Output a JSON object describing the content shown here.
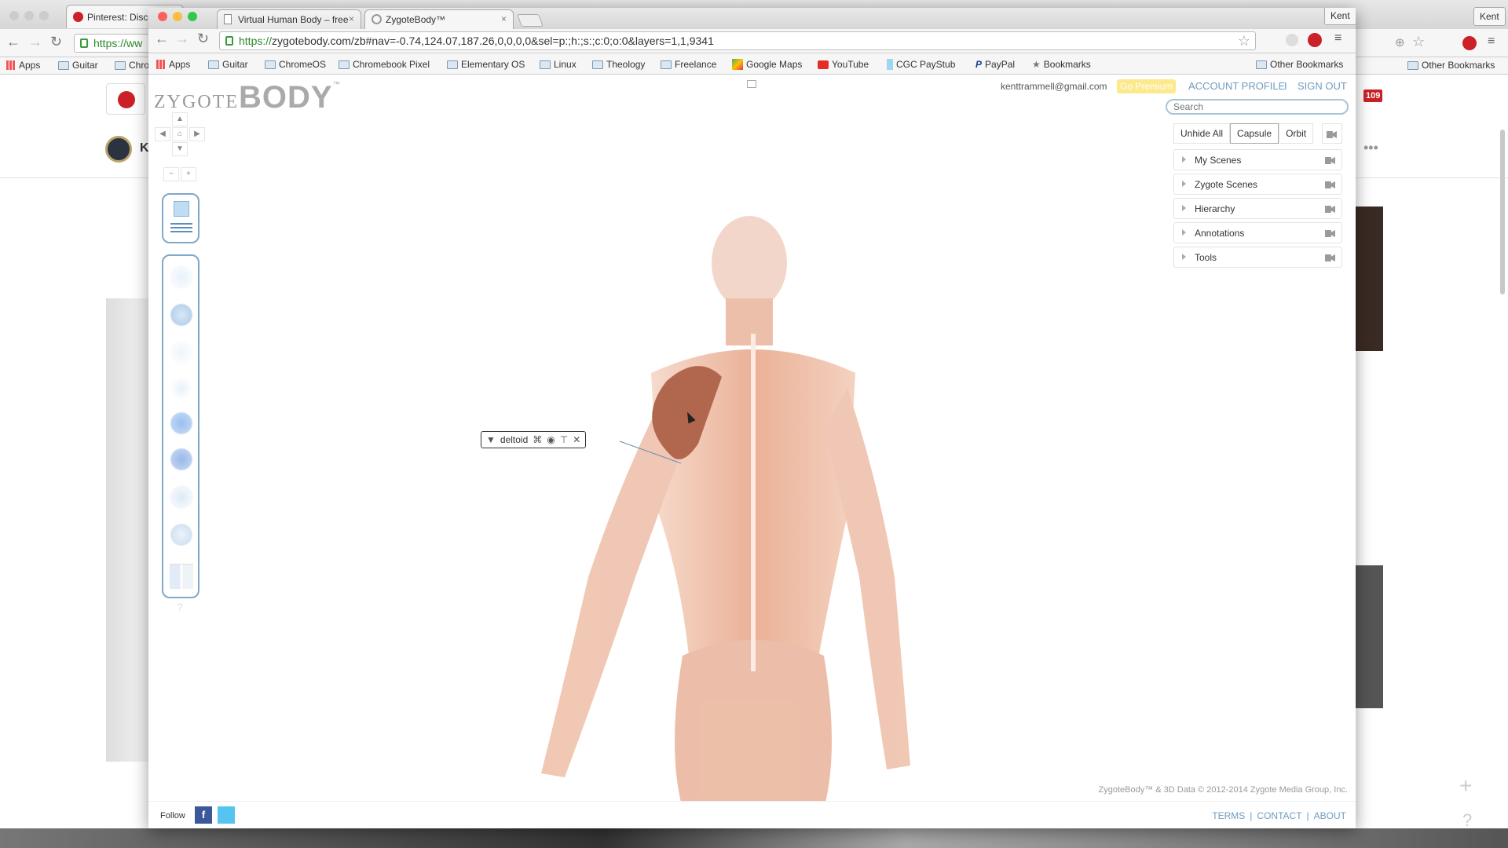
{
  "back_window": {
    "tab_title": "Pinterest: Disco",
    "url": "https://ww",
    "bookmarks": [
      "Apps",
      "Guitar",
      "Chro"
    ],
    "other_bookmarks": "Other Bookmarks",
    "profile": "Kent",
    "notification_count": "109",
    "initial": "K"
  },
  "front_window": {
    "tabs": [
      {
        "title": "Virtual Human Body – free",
        "active": false
      },
      {
        "title": "ZygoteBody™",
        "active": true
      }
    ],
    "profile": "Kent",
    "url_scheme": "https://",
    "url_rest": "zygotebody.com/zb#nav=-0.74,124.07,187.26,0,0,0,0&sel=p:;h:;s:;c:0;o:0&layers=1,1,9341",
    "bookmarks": [
      "Apps",
      "Guitar",
      "ChromeOS",
      "Chromebook Pixel",
      "Elementary OS",
      "Linux",
      "Theology",
      "Freelance",
      "Google Maps",
      "YouTube",
      "CGC PayStub",
      "PayPal",
      "Bookmarks"
    ],
    "other_bookmarks": "Other Bookmarks"
  },
  "app": {
    "logo_left": "ZYGOTE",
    "logo_right": "BODY",
    "logo_tm": "™",
    "email": "kenttrammell@gmail.com",
    "premium": "Go Premium",
    "account_profile": "ACCOUNT PROFILE",
    "separator": "I",
    "sign_out": "SIGN OUT",
    "search_placeholder": "Search",
    "view_buttons": [
      "Unhide All",
      "Capsule",
      "Orbit"
    ],
    "active_view": "Capsule",
    "panel_items": [
      "My Scenes",
      "Zygote Scenes",
      "Hierarchy",
      "Annotations",
      "Tools"
    ],
    "layer_icons": [
      "skin-icon",
      "muscle-icon",
      "ligament-icon",
      "bone-icon",
      "stomach-icon",
      "heart-icon",
      "nerve-icon",
      "brain-icon"
    ],
    "selected_label": "deltoid",
    "copyright": "ZygoteBody™ & 3D Data © 2012-2014 Zygote Media Group, Inc.",
    "footer": {
      "follow": "Follow",
      "links": [
        "TERMS",
        "CONTACT",
        "ABOUT"
      ],
      "divider": "|"
    },
    "help": "?"
  },
  "colors": {
    "accent": "#6f9cc0",
    "premium": "#fbe98a",
    "pinterest": "#cb2027",
    "muscle": "#b5694a",
    "skin": "#f1c7b1"
  }
}
